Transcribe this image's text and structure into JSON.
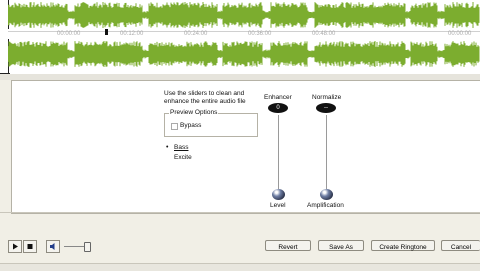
{
  "timeline": {
    "ticks": [
      "00:00:00",
      "00:12:00",
      "00:24:00",
      "00:36:00",
      "00:48:00",
      "00:00:00"
    ]
  },
  "wave_color": "#7cad2f",
  "effects": {
    "instruction": "Use the sliders to clean and enhance the entire audio file",
    "preview_legend": "Preview Options",
    "bypass_label": "Bypass",
    "options": [
      "Bass",
      "Excite"
    ]
  },
  "sliders": {
    "enhancer": {
      "title": "Enhancer",
      "value": "0",
      "label": "Level"
    },
    "normalize": {
      "title": "Normalize",
      "value": "--",
      "label": "Amplification"
    }
  },
  "buttons": {
    "revert": "Revert",
    "save_as": "Save As",
    "create_ringtone": "Create Ringtone",
    "cancel": "Cancel"
  },
  "transport": {
    "play_icon": "play-icon",
    "stop_icon": "stop-icon",
    "volume_icon": "speaker-icon",
    "volume_level": 0.9
  }
}
